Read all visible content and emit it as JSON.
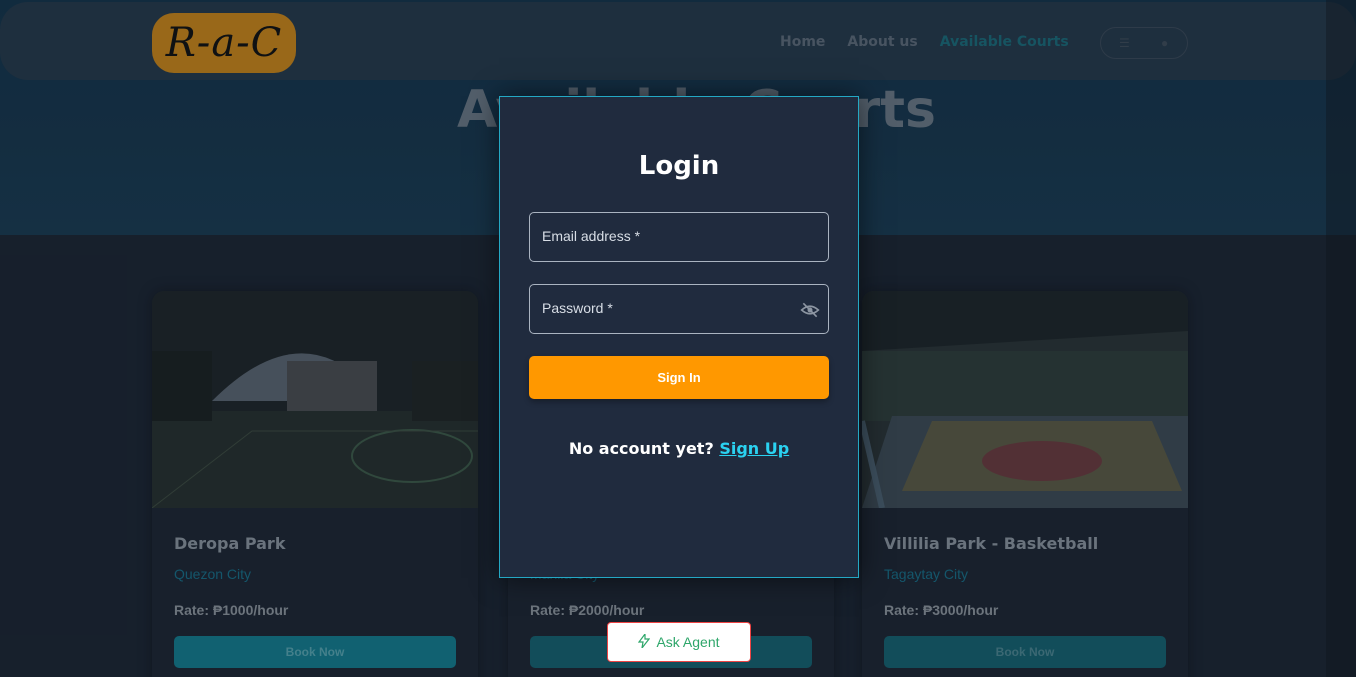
{
  "brand": {
    "logo_text": "R-a-C"
  },
  "nav": {
    "links": [
      {
        "label": "Home"
      },
      {
        "label": "About us"
      },
      {
        "label": "Available Courts"
      }
    ]
  },
  "hero": {
    "title": "Available Courts"
  },
  "courts": [
    {
      "name": "Deropa Park",
      "city": "Quezon City",
      "rate": "Rate: ₱1000/hour",
      "button": "Book Now"
    },
    {
      "name": "",
      "city": "Manila City",
      "rate": "Rate: ₱2000/hour",
      "button": "Book Now"
    },
    {
      "name": "Villilia Park - Basketball",
      "city": "Tagaytay City",
      "rate": "Rate: ₱3000/hour",
      "button": "Book Now"
    }
  ],
  "login": {
    "title": "Login",
    "email_label": "Email address *",
    "password_label": "Password *",
    "signin_label": "Sign In",
    "no_account_text": "No account yet?",
    "signup_label": "Sign Up"
  },
  "ask_agent": {
    "label": "Ask Agent"
  },
  "colors": {
    "accent": "#ff9800",
    "modal_border": "#24a8c4",
    "link": "#2ad1f0",
    "logo_bg": "#c88419"
  }
}
